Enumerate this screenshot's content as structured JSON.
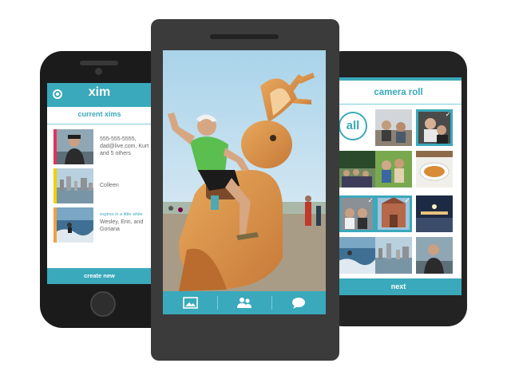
{
  "left_phone": {
    "header_title": "xim",
    "subtitle": "current xims",
    "items": [
      {
        "text": "555-555-5555, dad@live.com, Kurt and 5 others",
        "note": ""
      },
      {
        "text": "Colleen",
        "note": ""
      },
      {
        "text": "Wesley, Erin, and Goriana",
        "note": "expires in a little while"
      }
    ],
    "bar_colors": [
      "#e0345a",
      "#f0d000",
      "#f0a040"
    ],
    "footer_label": "create new"
  },
  "right_phone": {
    "header_title": "camera roll",
    "all_label": "all",
    "footer_label": "next",
    "check_glyph": "✓",
    "selected_tiles": [
      3,
      7,
      8
    ]
  },
  "center_phone": {
    "tabs": [
      {
        "icon": "gallery-icon"
      },
      {
        "icon": "people-icon"
      },
      {
        "icon": "chat-icon"
      }
    ]
  },
  "colors": {
    "accent": "#3aa9bb",
    "accent_light": "#7fcfdc",
    "phone_dark": "#1b1b1b",
    "phone_gray": "#3b3b3b"
  }
}
